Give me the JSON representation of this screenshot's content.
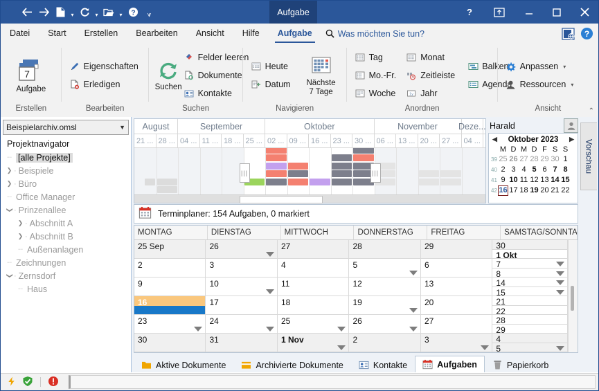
{
  "titlebar": {
    "qat": [
      {
        "name": "back-icon",
        "glyph": "←"
      },
      {
        "name": "forward-icon",
        "glyph": "→"
      },
      {
        "name": "new-document-icon",
        "glyph": "doc"
      },
      {
        "name": "refresh-icon",
        "glyph": "↻"
      },
      {
        "name": "open-folder-icon",
        "glyph": "folder"
      },
      {
        "name": "help-circle-icon",
        "glyph": "?"
      },
      {
        "name": "overflow-icon",
        "glyph": "▾"
      }
    ],
    "tab_label": "Aufgabe",
    "help": "?",
    "ribbon_display": "⊼",
    "minimize": "—",
    "maximize": "▢",
    "close": "✕"
  },
  "menubar": {
    "items": [
      {
        "label": "Datei",
        "active": false
      },
      {
        "label": "Start",
        "active": false
      },
      {
        "label": "Erstellen",
        "active": false
      },
      {
        "label": "Bearbeiten",
        "active": false
      },
      {
        "label": "Ansicht",
        "active": false
      },
      {
        "label": "Hilfe",
        "active": false
      },
      {
        "label": "Aufgabe",
        "active": true
      }
    ],
    "tellme": "Was möchten Sie tun?",
    "right_icons": [
      "web-icon",
      "help-blue-icon"
    ]
  },
  "ribbon": {
    "groups": [
      {
        "label": "Erstellen",
        "big": {
          "name": "aufgabe-big-button",
          "label": "Aufgabe",
          "badge": "7"
        },
        "cols": []
      },
      {
        "label": "Bearbeiten",
        "big": null,
        "cols": [
          [
            {
              "name": "eigenschaften-button",
              "icon": "pencil-icon",
              "label": "Eigenschaften"
            },
            {
              "name": "erledigen-button",
              "icon": "doc-cancel-icon",
              "label": "Erledigen"
            }
          ]
        ]
      },
      {
        "label": "Suchen",
        "big": {
          "name": "suchen-big-button",
          "label": "Suchen",
          "badge": ""
        },
        "cols": [
          [
            {
              "name": "felder-leeren-button",
              "icon": "eraser-icon",
              "label": "Felder leeren"
            },
            {
              "name": "dokumente-button",
              "icon": "doc-search-icon",
              "label": "Dokumente"
            },
            {
              "name": "kontakte-button",
              "icon": "contact-card-icon",
              "label": "Kontakte"
            }
          ]
        ]
      },
      {
        "label": "Navigieren",
        "big": {
          "name": "naechste-7-tage-button",
          "label": "Nächste\n7 Tage",
          "badge": ""
        },
        "cols": [
          [
            {
              "name": "heute-button",
              "icon": "calendar-grid-icon",
              "label": "Heute"
            },
            {
              "name": "datum-button",
              "icon": "calendar-goto-icon",
              "label": "Datum"
            }
          ]
        ]
      },
      {
        "label": "Anordnen",
        "big": null,
        "cols": [
          [
            {
              "name": "tag-button",
              "icon": "calendar-grid-icon",
              "label": "Tag"
            },
            {
              "name": "mo-fr-button",
              "icon": "calendar-grid-icon",
              "label": "Mo.-Fr."
            },
            {
              "name": "woche-button",
              "icon": "calendar-grid-icon",
              "label": "Woche"
            }
          ],
          [
            {
              "name": "monat-button",
              "icon": "calendar-grid-icon",
              "label": "Monat"
            },
            {
              "name": "zeitleiste-button",
              "icon": "timeline-icon",
              "label": "Zeitleiste"
            },
            {
              "name": "jahr-button",
              "icon": "year-icon",
              "label": "Jahr"
            }
          ],
          [
            {
              "name": "balken-button",
              "icon": "bars-icon",
              "label": "Balken"
            },
            {
              "name": "agenda-button",
              "icon": "agenda-icon",
              "label": "Agenda"
            }
          ]
        ]
      },
      {
        "label": "Ansicht",
        "big": null,
        "cols": [
          [
            {
              "name": "anpassen-button",
              "icon": "gear-icon",
              "label": "Anpassen",
              "caret": "▾"
            },
            {
              "name": "ressourcen-button",
              "icon": "person-icon",
              "label": "Ressourcen",
              "caret": "▾"
            }
          ]
        ]
      }
    ],
    "collapse_glyph": "⌃"
  },
  "sidebar": {
    "archive_select": "Beispielarchiv.omsl",
    "nav_title": "Projektnavigator",
    "tree": [
      {
        "label": "[alle Projekte]",
        "indent": 0,
        "marker": "dash",
        "selected": true
      },
      {
        "label": "Beispiele",
        "indent": 0,
        "marker": "collapsed",
        "selected": false
      },
      {
        "label": "Büro",
        "indent": 0,
        "marker": "collapsed",
        "selected": false
      },
      {
        "label": "Office Manager",
        "indent": 0,
        "marker": "dash",
        "selected": false
      },
      {
        "label": "Prinzenallee",
        "indent": 0,
        "marker": "expanded",
        "selected": false
      },
      {
        "label": "Abschnitt A",
        "indent": 1,
        "marker": "collapsed",
        "selected": false
      },
      {
        "label": "Abschnitt B",
        "indent": 1,
        "marker": "collapsed",
        "selected": false
      },
      {
        "label": "Außenanlagen",
        "indent": 1,
        "marker": "dash",
        "selected": false
      },
      {
        "label": "Zeichnungen",
        "indent": 0,
        "marker": "dash",
        "selected": false
      },
      {
        "label": "Zernsdorf",
        "indent": 0,
        "marker": "expanded",
        "selected": false
      },
      {
        "label": "Haus",
        "indent": 1,
        "marker": "dash",
        "selected": false
      }
    ]
  },
  "timeline": {
    "months": [
      {
        "label": "August",
        "span": 2
      },
      {
        "label": "September",
        "span": 4
      },
      {
        "label": "Oktober",
        "span": 5
      },
      {
        "label": "November",
        "span": 4
      },
      {
        "label": "Deze...",
        "span": 1
      }
    ],
    "weeks": [
      "21 ...",
      "28 ...",
      "04 ...",
      "11 ...",
      "18 ...",
      "25 ...",
      "02 ...",
      "09 ...",
      "16 ...",
      "23 ...",
      "30 ...",
      "06 ...",
      "13 ...",
      "20 ...",
      "27 ...",
      "04 ..."
    ],
    "colors": {
      "red": "#f48070",
      "purple": "#c3a0ee",
      "green": "#9bd45c",
      "gray": "#7d7f8c",
      "light": "#dcdcdc",
      "lighter": "#e4e4e4"
    },
    "bars": [
      {
        "col": 1,
        "row": 0,
        "w": 1,
        "color": "light"
      },
      {
        "col": 1,
        "row": 1,
        "w": 1,
        "color": "light"
      },
      {
        "col": 0.45,
        "row": 1,
        "w": 0.55,
        "color": "light"
      },
      {
        "col": 5,
        "row": 1,
        "w": 1,
        "color": "green"
      },
      {
        "col": 6,
        "row": 1,
        "w": 1,
        "color": "gray"
      },
      {
        "col": 6,
        "row": 2,
        "w": 1,
        "color": "red"
      },
      {
        "col": 6,
        "row": 3,
        "w": 1,
        "color": "purple"
      },
      {
        "col": 6,
        "row": 4,
        "w": 1,
        "color": "red"
      },
      {
        "col": 6,
        "row": 5,
        "w": 1,
        "color": "red"
      },
      {
        "col": 7,
        "row": 1,
        "w": 1,
        "color": "red"
      },
      {
        "col": 7,
        "row": 2,
        "w": 1,
        "color": "gray"
      },
      {
        "col": 7,
        "row": 3,
        "w": 1,
        "color": "red"
      },
      {
        "col": 8,
        "row": 1,
        "w": 1,
        "color": "purple"
      },
      {
        "col": 9,
        "row": 1,
        "w": 1,
        "color": "gray"
      },
      {
        "col": 9,
        "row": 2,
        "w": 1,
        "color": "gray"
      },
      {
        "col": 9,
        "row": 3,
        "w": 1,
        "color": "gray"
      },
      {
        "col": 9,
        "row": 4,
        "w": 1,
        "color": "gray"
      },
      {
        "col": 10,
        "row": 1,
        "w": 1,
        "color": "gray"
      },
      {
        "col": 10,
        "row": 2,
        "w": 1,
        "color": "gray"
      },
      {
        "col": 10,
        "row": 3,
        "w": 1,
        "color": "gray"
      },
      {
        "col": 10,
        "row": 4,
        "w": 1,
        "color": "red"
      },
      {
        "col": 10,
        "row": 5,
        "w": 1,
        "color": "gray"
      },
      {
        "col": 10,
        "row": 6,
        "w": 1,
        "color": "gray"
      },
      {
        "col": 11,
        "row": 1,
        "w": 1,
        "color": "lighter"
      },
      {
        "col": 11,
        "row": 2,
        "w": 1,
        "color": "lighter"
      },
      {
        "col": 11,
        "row": 3,
        "w": 1,
        "color": "lighter"
      },
      {
        "col": 13,
        "row": 1,
        "w": 1,
        "color": "lighter"
      },
      {
        "col": 13,
        "row": 2,
        "w": 1,
        "color": "lighter"
      },
      {
        "col": 14,
        "row": 1,
        "w": 1,
        "color": "lighter"
      },
      {
        "col": 14,
        "row": 2,
        "w": 1,
        "color": "lighter"
      }
    ]
  },
  "minicalendar": {
    "user": "Harald",
    "prev": "◀",
    "next": "▶",
    "title": "Oktober 2023",
    "dow": [
      "M",
      "D",
      "M",
      "D",
      "F",
      "S",
      "S"
    ],
    "weeks": [
      {
        "wk": "39",
        "days": [
          {
            "d": "25",
            "o": true
          },
          {
            "d": "26",
            "o": true,
            "b": true
          },
          {
            "d": "27",
            "o": true
          },
          {
            "d": "28",
            "o": true
          },
          {
            "d": "29",
            "o": true
          },
          {
            "d": "30",
            "o": true
          },
          {
            "d": "1"
          }
        ]
      },
      {
        "wk": "40",
        "days": [
          {
            "d": "2"
          },
          {
            "d": "3"
          },
          {
            "d": "4"
          },
          {
            "d": "5",
            "b": true
          },
          {
            "d": "6"
          },
          {
            "d": "7",
            "b": true
          },
          {
            "d": "8",
            "b": true
          }
        ]
      },
      {
        "wk": "41",
        "days": [
          {
            "d": "9"
          },
          {
            "d": "10",
            "b": true
          },
          {
            "d": "11"
          },
          {
            "d": "12"
          },
          {
            "d": "13"
          },
          {
            "d": "14",
            "b": true
          },
          {
            "d": "15",
            "b": true
          }
        ]
      },
      {
        "wk": "42",
        "days": [
          {
            "d": "16",
            "today": true
          },
          {
            "d": "17"
          },
          {
            "d": "18"
          },
          {
            "d": "19",
            "b": true
          },
          {
            "d": "20"
          },
          {
            "d": "21"
          },
          {
            "d": "22"
          }
        ]
      }
    ]
  },
  "preview_tab": "Vorschau",
  "planner": {
    "icon": "calendar-red-icon",
    "text": "Terminplaner:  154 Aufgaben, 0 markiert"
  },
  "calendar": {
    "headers": [
      "MONTAG",
      "DIENSTAG",
      "MITTWOCH",
      "DONNERSTAG",
      "FREITAG",
      "SAMSTAG/SONNTAG"
    ],
    "rows": [
      {
        "weekday": [
          {
            "d": "25 Sep",
            "other": true
          },
          {
            "d": "26",
            "other": true,
            "tri": true
          },
          {
            "d": "27",
            "other": true
          },
          {
            "d": "28",
            "other": true
          },
          {
            "d": "29",
            "other": true
          }
        ],
        "sat": {
          "d": "30",
          "other": true
        },
        "sun": {
          "d": "1 Okt",
          "bold": true
        }
      },
      {
        "weekday": [
          {
            "d": "2"
          },
          {
            "d": "3"
          },
          {
            "d": "4"
          },
          {
            "d": "5",
            "tri": true
          },
          {
            "d": "6"
          }
        ],
        "sat": {
          "d": "7",
          "tri": true
        },
        "sun": {
          "d": "8",
          "tri": true
        }
      },
      {
        "weekday": [
          {
            "d": "9"
          },
          {
            "d": "10",
            "tri": true
          },
          {
            "d": "11"
          },
          {
            "d": "12"
          },
          {
            "d": "13"
          }
        ],
        "sat": {
          "d": "14",
          "tri": true
        },
        "sun": {
          "d": "15",
          "tri": true
        }
      },
      {
        "weekday": [
          {
            "d": "16",
            "selected": true
          },
          {
            "d": "17"
          },
          {
            "d": "18"
          },
          {
            "d": "19",
            "tri": true
          },
          {
            "d": "20"
          }
        ],
        "sat": {
          "d": "21"
        },
        "sun": {
          "d": "22"
        }
      },
      {
        "weekday": [
          {
            "d": "23",
            "tri": true
          },
          {
            "d": "24",
            "tri": true
          },
          {
            "d": "25",
            "tri": true
          },
          {
            "d": "26",
            "tri": true
          },
          {
            "d": "27"
          }
        ],
        "sat": {
          "d": "28"
        },
        "sun": {
          "d": "29"
        }
      },
      {
        "weekday": [
          {
            "d": "30",
            "other": true
          },
          {
            "d": "31",
            "other": true
          },
          {
            "d": "1 Nov",
            "other": true,
            "bold": true,
            "tri": true
          },
          {
            "d": "2",
            "other": true
          },
          {
            "d": "3",
            "other": true,
            "tri": true
          }
        ],
        "sat": {
          "d": "4",
          "other": true
        },
        "sun": {
          "d": "5",
          "other": true,
          "tri": true
        }
      }
    ]
  },
  "bottom_tabs": [
    {
      "label": "Aktive Dokumente",
      "icon": "folder-icon",
      "active": false
    },
    {
      "label": "Archivierte Dokumente",
      "icon": "archive-folder-icon",
      "active": false
    },
    {
      "label": "Kontakte",
      "icon": "contact-card-icon",
      "active": false
    },
    {
      "label": "Aufgaben",
      "icon": "calendar-red-icon",
      "active": true
    },
    {
      "label": "Papierkorb",
      "icon": "trash-icon",
      "active": false
    }
  ],
  "statusbar": {
    "icons": [
      "lightning-icon",
      "shield-ok-icon",
      "error-icon"
    ]
  }
}
